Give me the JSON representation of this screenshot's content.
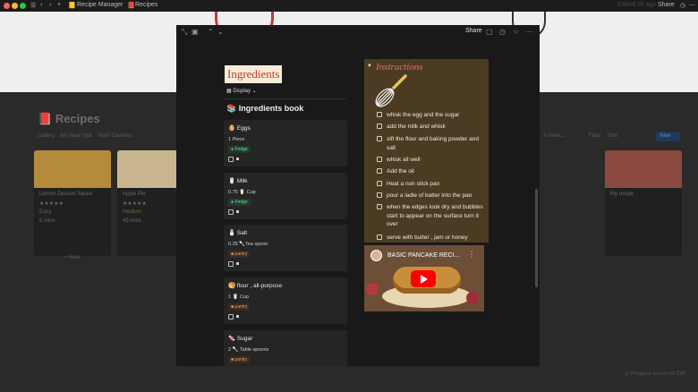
{
  "window": {
    "breadcrumb_app": "Recipe Manager",
    "breadcrumb_page": "Recipes",
    "right_edited": "Edited 1h ago",
    "right_share": "Share"
  },
  "background": {
    "page_title": "Recipes",
    "tabs": [
      "Gallery",
      "My meal type",
      "Main Courses"
    ],
    "cards": [
      {
        "name": "Lemon Dessert Sauce",
        "rating": "★★★★★",
        "tag": "Easy",
        "time": "5 mins"
      },
      {
        "name": "Apple Pie",
        "rating": "★★★★★",
        "tag": "Medium",
        "time": "45 mins"
      },
      {
        "name": "My recipe"
      }
    ],
    "toolbar_right": [
      "...",
      "3 more...",
      "Filter",
      "Sort"
    ],
    "new_button": "New",
    "new_item": "+ New",
    "request_access": "Request access to Edit"
  },
  "modal": {
    "share_label": "Share",
    "ingredients_heading": "Ingredients",
    "display_label": "Display",
    "book_title": "Ingredients book",
    "ingredients": [
      {
        "name": "Eggs",
        "qty": "1 Piece",
        "tag": "Fridge",
        "tag_type": "fridge",
        "icon": "🥚"
      },
      {
        "name": "Milk",
        "qty": "0.75 🥛 Cup",
        "tag": "Fridge",
        "tag_type": "fridge",
        "icon": "🥛"
      },
      {
        "name": "Salt",
        "qty": "0.25 🥄Tea spoon",
        "tag": "pantry",
        "tag_type": "pantry",
        "icon": "🧂"
      },
      {
        "name": "flour , all-purpose",
        "qty": "1 🥛 Cup",
        "tag": "pantry",
        "tag_type": "pantry",
        "icon": "🥞"
      },
      {
        "name": "Sugar",
        "qty": "2 🥄 Table spoons",
        "tag": "pantry",
        "tag_type": "pantry",
        "icon": "🍬"
      }
    ],
    "instructions_title": "Instructions",
    "steps": [
      "whisk the egg and the sugar",
      "add the milk and whisk",
      "sift the flour and baking powder and salt",
      "whisk all well",
      "Add the oil",
      "Heat a non stick pan",
      "pour a ladle of batter into the pan",
      "when the edges look dry and bubbles start to appear on the surface turn it over",
      "serve with butter , jam or honey"
    ],
    "video_title": "BASIC PANCAKE RECI..."
  }
}
